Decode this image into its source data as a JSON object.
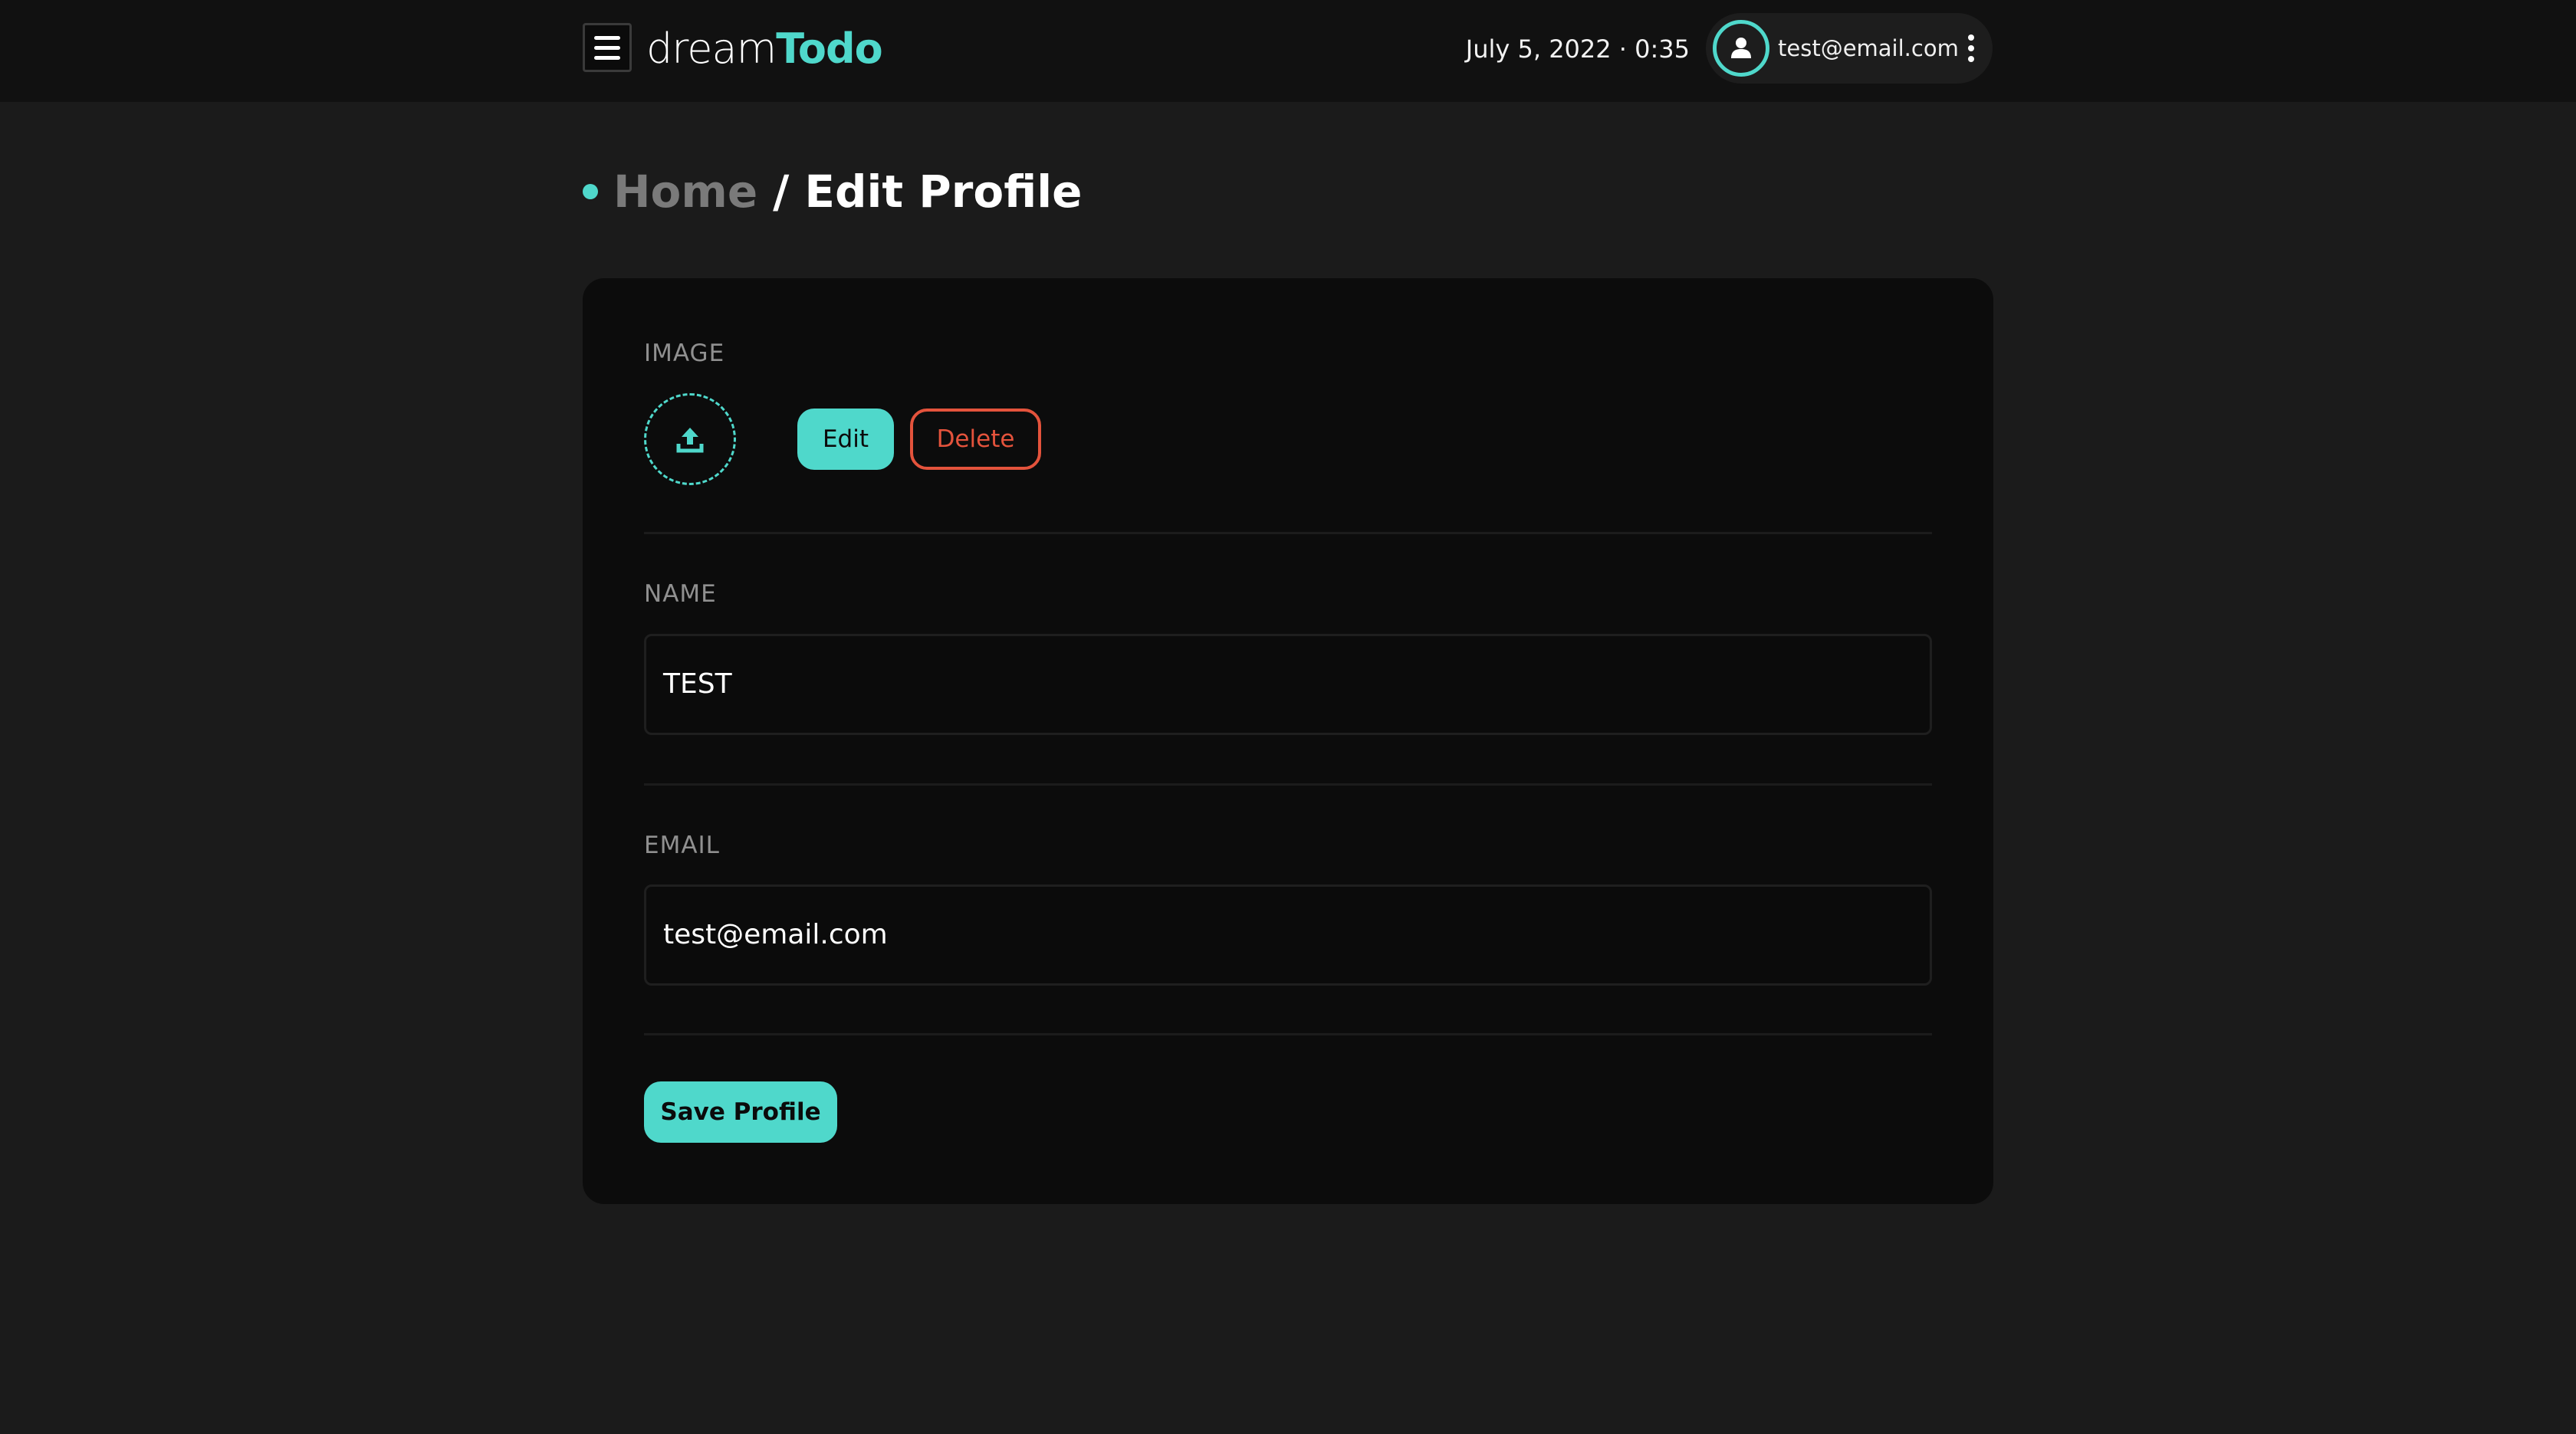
{
  "app": {
    "logo_part1": "dream",
    "logo_part2": "Todo",
    "accent_color": "#4fd8cb",
    "danger_color": "#e4533c"
  },
  "header": {
    "datetime": "July 5, 2022 · 0:35",
    "user_email": "test@email.com",
    "icons": [
      "hamburger-menu-icon",
      "user-icon",
      "more-vertical-icon"
    ]
  },
  "breadcrumb": {
    "home": "Home",
    "separator": "/",
    "current": "Edit Profile"
  },
  "profile_form": {
    "image": {
      "label": "IMAGE",
      "upload_icon": "upload-icon",
      "edit_label": "Edit",
      "delete_label": "Delete"
    },
    "name": {
      "label": "NAME",
      "value": "TEST"
    },
    "email": {
      "label": "EMAIL",
      "value": "test@email.com"
    },
    "save_label": "Save Profile"
  }
}
